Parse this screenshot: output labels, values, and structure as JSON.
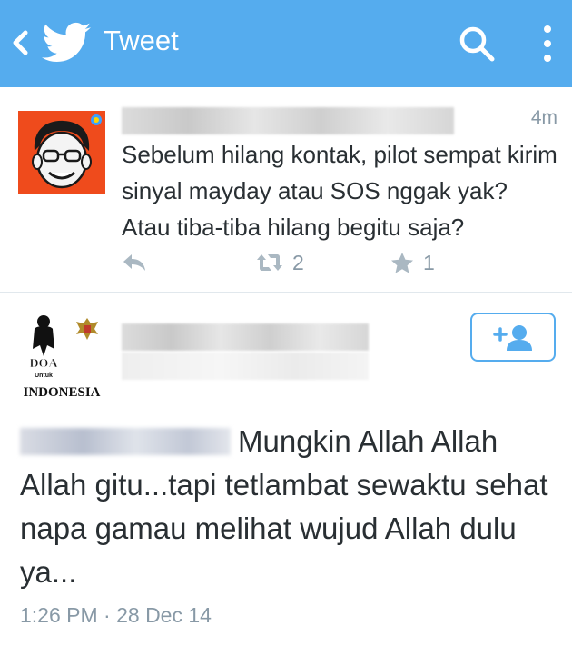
{
  "header": {
    "title": "Tweet",
    "back_icon": "chevron-left-icon",
    "logo_icon": "twitter-bird-icon",
    "search_icon": "search-icon",
    "more_icon": "more-vertical-icon",
    "background_color": "#55acee"
  },
  "tweet1": {
    "time": "4m",
    "text": "Sebelum hilang kontak, pilot sempat kirim sinyal mayday atau SOS nggak yak? Atau tiba-tiba hilang begitu saja?",
    "retweets": "2",
    "favorites": "1"
  },
  "tweet2": {
    "avatar_text_top": "DOA",
    "avatar_text_mid": "Untuk",
    "avatar_text_bottom": "INDONESIA",
    "text": "Mungkin Allah Allah Allah gitu...tapi tetlambat sewaktu sehat napa gamau melihat wujud Allah dulu ya...",
    "timestamp": "1:26 PM · 28 Dec 14"
  }
}
